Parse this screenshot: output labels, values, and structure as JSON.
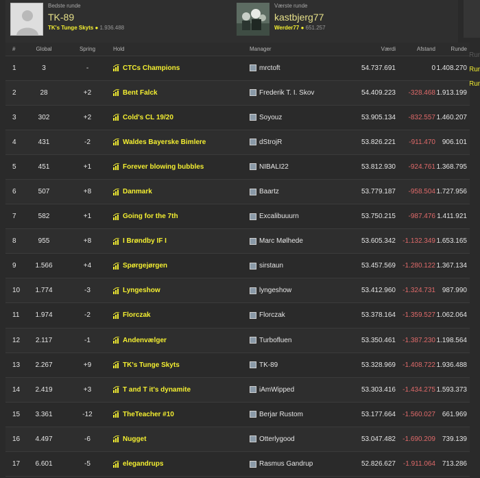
{
  "header": {
    "best": {
      "label": "Bedste runde",
      "name": "TK-89",
      "team": "TK's Tunge Skyts",
      "dot": "●",
      "points": "1.936.488"
    },
    "worst": {
      "label": "Værste runde",
      "name": "kastbjerg77",
      "team": "Werder77",
      "dot": "●",
      "points": "651.257"
    }
  },
  "side": {
    "label1": "Run",
    "label2": "Run",
    "label3": "Run"
  },
  "columns": {
    "rank": "#",
    "global": "Global",
    "spring": "Spring",
    "team": "Hold",
    "manager": "Manager",
    "value": "Værdi",
    "diff": "Afstand",
    "round": "Runde"
  },
  "rows": [
    {
      "rank": "1",
      "global": "3",
      "spring": "-",
      "team": "CTCs Champions",
      "manager": "mrctoft",
      "value": "54.737.691",
      "diff": "0",
      "round": "1.408.270"
    },
    {
      "rank": "2",
      "global": "28",
      "spring": "+2",
      "team": "Bent Falck",
      "manager": "Frederik T. I. Skov",
      "value": "54.409.223",
      "diff": "-328.468",
      "round": "1.913.199"
    },
    {
      "rank": "3",
      "global": "302",
      "spring": "+2",
      "team": "Cold's CL 19/20",
      "manager": "Soyouz",
      "value": "53.905.134",
      "diff": "-832.557",
      "round": "1.460.207"
    },
    {
      "rank": "4",
      "global": "431",
      "spring": "-2",
      "team": "Waldes Bayerske Bimlere",
      "manager": "dStrojR",
      "value": "53.826.221",
      "diff": "-911.470",
      "round": "906.101"
    },
    {
      "rank": "5",
      "global": "451",
      "spring": "+1",
      "team": "Forever blowing bubbles",
      "manager": "NIBALI22",
      "value": "53.812.930",
      "diff": "-924.761",
      "round": "1.368.795"
    },
    {
      "rank": "6",
      "global": "507",
      "spring": "+8",
      "team": "Danmark",
      "manager": "Baartz",
      "value": "53.779.187",
      "diff": "-958.504",
      "round": "1.727.956"
    },
    {
      "rank": "7",
      "global": "582",
      "spring": "+1",
      "team": "Going for the 7th",
      "manager": "Excalibuuurn",
      "value": "53.750.215",
      "diff": "-987.476",
      "round": "1.411.921"
    },
    {
      "rank": "8",
      "global": "955",
      "spring": "+8",
      "team": "I Brøndby IF I",
      "manager": "Marc Mølhede",
      "value": "53.605.342",
      "diff": "-1.132.349",
      "round": "1.653.165"
    },
    {
      "rank": "9",
      "global": "1.566",
      "spring": "+4",
      "team": "Spørgejørgen",
      "manager": "sirstaun",
      "value": "53.457.569",
      "diff": "-1.280.122",
      "round": "1.367.134"
    },
    {
      "rank": "10",
      "global": "1.774",
      "spring": "-3",
      "team": "Lyngeshow",
      "manager": "lyngeshow",
      "value": "53.412.960",
      "diff": "-1.324.731",
      "round": "987.990"
    },
    {
      "rank": "11",
      "global": "1.974",
      "spring": "-2",
      "team": "Florczak",
      "manager": "Florczak",
      "value": "53.378.164",
      "diff": "-1.359.527",
      "round": "1.062.064"
    },
    {
      "rank": "12",
      "global": "2.117",
      "spring": "-1",
      "team": "Andenvælger",
      "manager": "Turbofluen",
      "value": "53.350.461",
      "diff": "-1.387.230",
      "round": "1.198.564"
    },
    {
      "rank": "13",
      "global": "2.267",
      "spring": "+9",
      "team": "TK's Tunge Skyts",
      "manager": "TK-89",
      "value": "53.328.969",
      "diff": "-1.408.722",
      "round": "1.936.488"
    },
    {
      "rank": "14",
      "global": "2.419",
      "spring": "+3",
      "team": "T and T it's dynamite",
      "manager": "iAmWipped",
      "value": "53.303.416",
      "diff": "-1.434.275",
      "round": "1.593.373"
    },
    {
      "rank": "15",
      "global": "3.361",
      "spring": "-12",
      "team": "TheTeacher #10",
      "manager": "Berjar Rustom",
      "value": "53.177.664",
      "diff": "-1.560.027",
      "round": "661.969"
    },
    {
      "rank": "16",
      "global": "4.497",
      "spring": "-6",
      "team": "Nugget",
      "manager": "Otterlygood",
      "value": "53.047.482",
      "diff": "-1.690.209",
      "round": "739.139"
    },
    {
      "rank": "17",
      "global": "6.601",
      "spring": "-5",
      "team": "elegandrups",
      "manager": "Rasmus Gandrup",
      "value": "52.826.627",
      "diff": "-1.911.064",
      "round": "713.286"
    }
  ],
  "colors": {
    "accent": "#f4ef31",
    "negative": "#e06a6a",
    "background": "#2a2a2a"
  },
  "icons": {
    "team": "bar-chart-icon",
    "manager": "user-avatar"
  }
}
